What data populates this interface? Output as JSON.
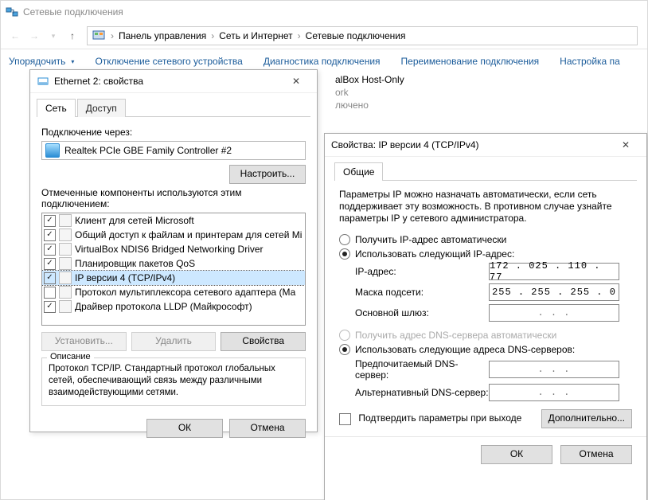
{
  "window": {
    "title": "Сетевые подключения"
  },
  "breadcrumb": {
    "seg1": "Панель управления",
    "seg2": "Сеть и Интернет",
    "seg3": "Сетевые подключения"
  },
  "cmdbar": {
    "organize": "Упорядочить",
    "disable": "Отключение сетевого устройства",
    "diag": "Диагностика подключения",
    "rename": "Переименование подключения",
    "settings": "Настройка па"
  },
  "bg_conn": {
    "line1": "alBox Host-Only",
    "line2": "ork",
    "line3": "лючено"
  },
  "eth_dlg": {
    "title": "Ethernet 2: свойства",
    "tab_net": "Сеть",
    "tab_access": "Доступ",
    "connect_via": "Подключение через:",
    "adapter": "Realtek PCIe GBE Family Controller #2",
    "configure": "Настроить...",
    "components_label": "Отмеченные компоненты используются этим подключением:",
    "components": [
      {
        "checked": true,
        "label": "Клиент для сетей Microsoft"
      },
      {
        "checked": true,
        "label": "Общий доступ к файлам и принтерам для сетей Mi"
      },
      {
        "checked": true,
        "label": "VirtualBox NDIS6 Bridged Networking Driver"
      },
      {
        "checked": true,
        "label": "Планировщик пакетов QoS"
      },
      {
        "checked": true,
        "label": "IP версии 4 (TCP/IPv4)",
        "selected": true
      },
      {
        "checked": false,
        "label": "Протокол мультиплексора сетевого адаптера (Ма"
      },
      {
        "checked": true,
        "label": "Драйвер протокола LLDP (Майкрософт)"
      }
    ],
    "install": "Установить...",
    "remove": "Удалить",
    "props": "Свойства",
    "desc_title": "Описание",
    "desc": "Протокол TCP/IP. Стандартный протокол глобальных сетей, обеспечивающий связь между различными взаимодействующими сетями.",
    "ok": "ОК",
    "cancel": "Отмена"
  },
  "ip_dlg": {
    "title": "Свойства: IP версии 4 (TCP/IPv4)",
    "tab_general": "Общие",
    "intro": "Параметры IP можно назначать автоматически, если сеть поддерживает эту возможность. В противном случае узнайте параметры IP у сетевого администратора.",
    "auto_ip": "Получить IP-адрес автоматически",
    "manual_ip": "Использовать следующий IP-адрес:",
    "ip_label": "IP-адрес:",
    "ip_value": "172 . 025 . 110 .  77",
    "mask_label": "Маска подсети:",
    "mask_value": "255 . 255 . 255 .  0",
    "gw_label": "Основной шлюз:",
    "gw_value": ".       .       .",
    "auto_dns": "Получить адрес DNS-сервера автоматически",
    "manual_dns": "Использовать следующие адреса DNS-серверов:",
    "dns1_label": "Предпочитаемый DNS-сервер:",
    "dns1_value": ".       .       .",
    "dns2_label": "Альтернативный DNS-сервер:",
    "dns2_value": ".       .       .",
    "confirm": "Подтвердить параметры при выходе",
    "advanced": "Дополнительно...",
    "ok": "ОК",
    "cancel": "Отмена"
  }
}
